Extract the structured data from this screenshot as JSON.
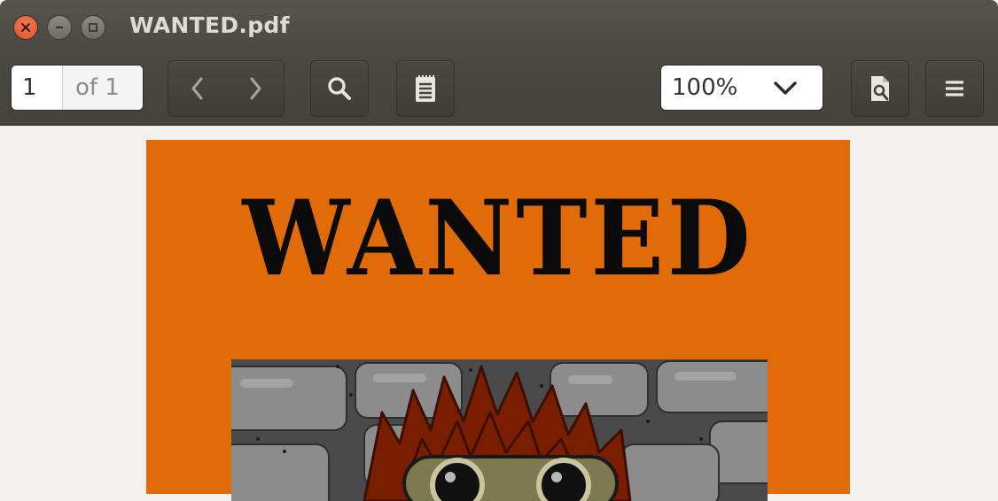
{
  "window": {
    "title": "WANTED.pdf"
  },
  "toolbar": {
    "page_current": "1",
    "page_total_label": "of 1",
    "zoom_value": "100%"
  },
  "icons": {
    "close": "close-icon",
    "minimize": "minimize-icon",
    "maximize": "maximize-icon",
    "prev": "chevron-left-icon",
    "next": "chevron-right-icon",
    "search": "search-icon",
    "sidebar": "notepad-icon",
    "zoom_dropdown": "chevron-down-icon",
    "document_find": "document-search-icon",
    "menu": "hamburger-icon"
  },
  "document": {
    "headline": "WANTED"
  },
  "colors": {
    "page_background": "#e26b09",
    "headline": "#0b0b0b",
    "close_button": "#e8592d",
    "titlebar": "#4e4c47"
  }
}
